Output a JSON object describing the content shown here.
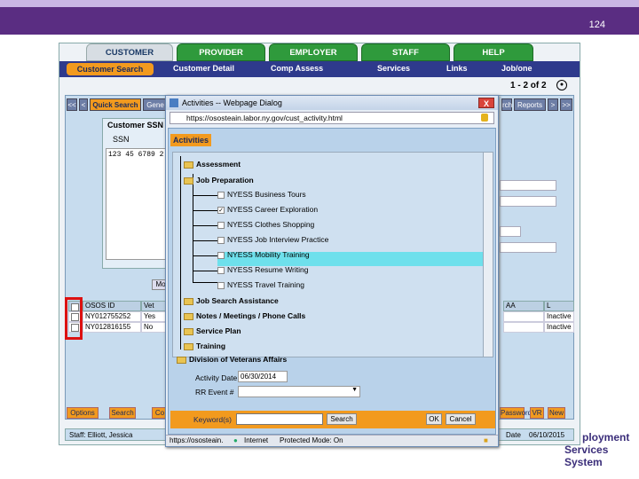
{
  "slide": {
    "number": "124"
  },
  "tabs": [
    {
      "label": "CUSTOMER",
      "active": true
    },
    {
      "label": "PROVIDER",
      "active": false
    },
    {
      "label": "EMPLOYER",
      "active": false
    },
    {
      "label": "STAFF",
      "active": false
    },
    {
      "label": "HELP",
      "active": false
    }
  ],
  "subnav": {
    "selected": "Customer Search",
    "items": [
      "Customer Detail",
      "Comp Assess",
      "Services",
      "Links",
      "Job/one"
    ]
  },
  "pagination": {
    "text": "1 - 2 of 2"
  },
  "navbar": {
    "quick_search": "Quick Search",
    "general": "Gene",
    "search": "rch",
    "reports": "Reports",
    "prev": "<<",
    "prev2": "<",
    "next": ">",
    "next2": ">>"
  },
  "customer_ssn": {
    "heading": "Customer SSN",
    "ssn_label": "SSN",
    "ssn_value": "123 45 6789 2",
    "more_btn": "Mo"
  },
  "grid": {
    "headers": [
      "OSOS ID",
      "Vet"
    ],
    "rows": [
      {
        "id": "NY012755252",
        "vet": "Yes"
      },
      {
        "id": "NY012816155",
        "vet": "No"
      }
    ],
    "right_headers": [
      "AA",
      "L"
    ],
    "right_rows": [
      "Inactive",
      "Inactive"
    ]
  },
  "bottom_buttons": {
    "options": "Options",
    "search": "Search",
    "co": "Co",
    "password": "Password",
    "vr": "VR",
    "new": "New"
  },
  "statusbar": {
    "staff": "Staff: Elliott, Jessica",
    "date_label": "Date",
    "date": "06/10/2015"
  },
  "logo": {
    "line1": "ployment",
    "line2": "Services System"
  },
  "dialog": {
    "title": "Activities -- Webpage Dialog",
    "close": "X",
    "url": "https://ososteain.labor.ny.gov/cust_activity.html",
    "activities_tab": "Activities",
    "tree": {
      "assessment": "Assessment",
      "job_preparation": "Job Preparation",
      "items": [
        {
          "label": "NYESS Business Tours",
          "checked": false
        },
        {
          "label": "NYESS Career Exploration",
          "checked": true
        },
        {
          "label": "NYESS Clothes Shopping",
          "checked": false
        },
        {
          "label": "NYESS Job Interview Practice",
          "checked": false
        },
        {
          "label": "NYESS Mobility Training",
          "checked": false
        },
        {
          "label": "NYESS Resume Writing",
          "checked": false
        },
        {
          "label": "NYESS Travel Training",
          "checked": false
        }
      ],
      "job_search": "Job Search Assistance",
      "notes": "Notes / Meetings / Phone Calls",
      "service_plan": "Service Plan",
      "training": "Training",
      "vr": "Division of Veterans Affairs"
    },
    "activity_date_label": "Activity Date",
    "activity_date": "06/30/2014",
    "rr_event_label": "RR Event #",
    "keyword_label": "Keyword(s)",
    "search_btn": "Search",
    "ok_btn": "OK",
    "cancel_btn": "Cancel",
    "status_url": "https://ososteain.",
    "status_zone": "Internet",
    "status_mode": "Protected Mode: On"
  }
}
